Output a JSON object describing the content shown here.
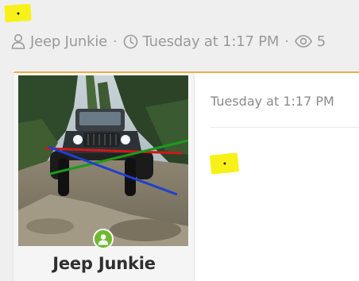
{
  "meta": {
    "author": "Jeep Junkie",
    "separator": "·",
    "date": "Tuesday at 1:17 PM",
    "views": "5",
    "icons": [
      "user-icon",
      "clock-icon",
      "eye-icon"
    ]
  },
  "post": {
    "author_name": "Jeep Junkie",
    "date": "Tuesday at 1:17 PM",
    "status": "online"
  },
  "colors": {
    "highlight": "#f7f117",
    "card_accent": "#e8b04a",
    "online": "#6fb82f",
    "annotation_red": "#d01818",
    "annotation_green": "#1a9a1a",
    "annotation_blue": "#1f3fd0"
  }
}
